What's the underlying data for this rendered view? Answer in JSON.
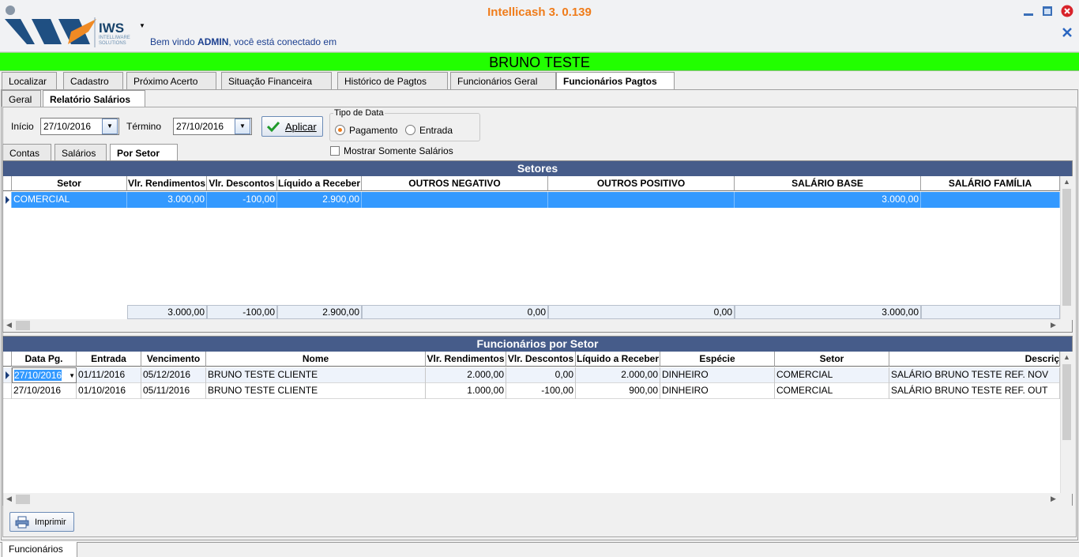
{
  "header": {
    "logo_text": "IWS",
    "logo_sub": "INTELLIWARE SOLUTIONS",
    "app_title": "Intellicash 3. 0.139",
    "welcome_prefix": "Bem vindo ",
    "welcome_user": "ADMIN",
    "welcome_suffix": ", você está conectado em"
  },
  "client_name": "BRUNO TESTE",
  "main_tabs": [
    "Localizar",
    "Cadastro",
    "Próximo Acerto",
    "Situação Financeira",
    "Histórico de Pagtos",
    "Funcionários Geral",
    "Funcionários Pagtos"
  ],
  "sub_tabs": [
    "Geral",
    "Relatório Salários"
  ],
  "filters": {
    "inicio_label": "Início",
    "inicio_value": "27/10/2016",
    "termino_label": "Término",
    "termino_value": "27/10/2016",
    "apply_label": "Aplicar",
    "tipo_label": "Tipo de Data",
    "opt_pagamento": "Pagamento",
    "opt_entrada": "Entrada",
    "only_salaries": "Mostrar Somente Salários"
  },
  "report_tabs": [
    "Contas",
    "Salários",
    "Por Setor"
  ],
  "setores": {
    "title": "Setores",
    "columns": [
      "Setor",
      "Vlr. Rendimentos",
      "Vlr. Descontos",
      "Líquido a Receber",
      "OUTROS NEGATIVO",
      "OUTROS POSITIVO",
      "SALÁRIO BASE",
      "SALÁRIO FAMÍLIA"
    ],
    "row": [
      "COMERCIAL",
      "3.000,00",
      "-100,00",
      "2.900,00",
      "",
      "",
      "3.000,00",
      ""
    ],
    "totals": [
      "3.000,00",
      "-100,00",
      "2.900,00",
      "0,00",
      "0,00",
      "3.000,00"
    ]
  },
  "funcionarios": {
    "title": "Funcionários por Setor",
    "columns": [
      "Data Pg.",
      "Entrada",
      "Vencimento",
      "Nome",
      "Vlr. Rendimentos",
      "Vlr. Descontos",
      "Líquido a Receber",
      "Espécie",
      "Setor",
      "Descriç"
    ],
    "rows": [
      [
        "27/10/2016",
        "01/11/2016",
        "05/12/2016",
        "BRUNO TESTE CLIENTE",
        "2.000,00",
        "0,00",
        "2.000,00",
        "DINHEIRO",
        "COMERCIAL",
        "SALÁRIO BRUNO TESTE REF. NOV"
      ],
      [
        "27/10/2016",
        "01/10/2016",
        "05/11/2016",
        "BRUNO TESTE CLIENTE",
        "1.000,00",
        "-100,00",
        "900,00",
        "DINHEIRO",
        "COMERCIAL",
        "SALÁRIO BRUNO TESTE REF. OUT"
      ]
    ]
  },
  "print_label": "Imprimir",
  "bottom_tab": "Funcionários",
  "colors": {
    "green_bar": "#22ff00",
    "grid_title": "#465c8a",
    "selection": "#3399ff",
    "title_orange": "#f07c1a"
  }
}
